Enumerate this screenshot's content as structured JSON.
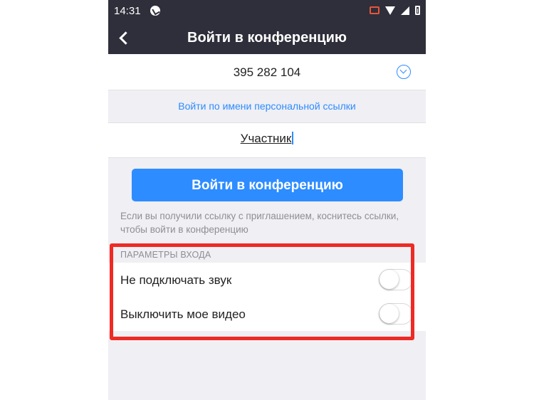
{
  "status_bar": {
    "time": "14:31",
    "icons": [
      "app-notification-icon",
      "cast-icon",
      "wifi-icon",
      "signal-icon",
      "battery-icon"
    ]
  },
  "app_bar": {
    "title": "Войти в конференцию",
    "back_icon": "chevron-left-icon"
  },
  "meeting": {
    "id": "395 282 104",
    "dropdown_icon": "chevron-down-circle-icon"
  },
  "personal_link_text": "Войти по имени персональной ссылки",
  "name_field": {
    "value": "Участник"
  },
  "join_button_label": "Войти в конференцию",
  "hint": "Если вы получили ссылку с приглашением, коснитесь ссылки, чтобы войти в конференцию",
  "options": {
    "header": "ПАРАМЕТРЫ ВХОДА",
    "items": [
      {
        "label": "Не подключать звук",
        "enabled": false
      },
      {
        "label": "Выключить мое видео",
        "enabled": false
      }
    ]
  },
  "colors": {
    "accent": "#2d8cff",
    "top_bar": "#2e2f3a",
    "highlight": "#ee2a24",
    "background": "#efeff4"
  }
}
